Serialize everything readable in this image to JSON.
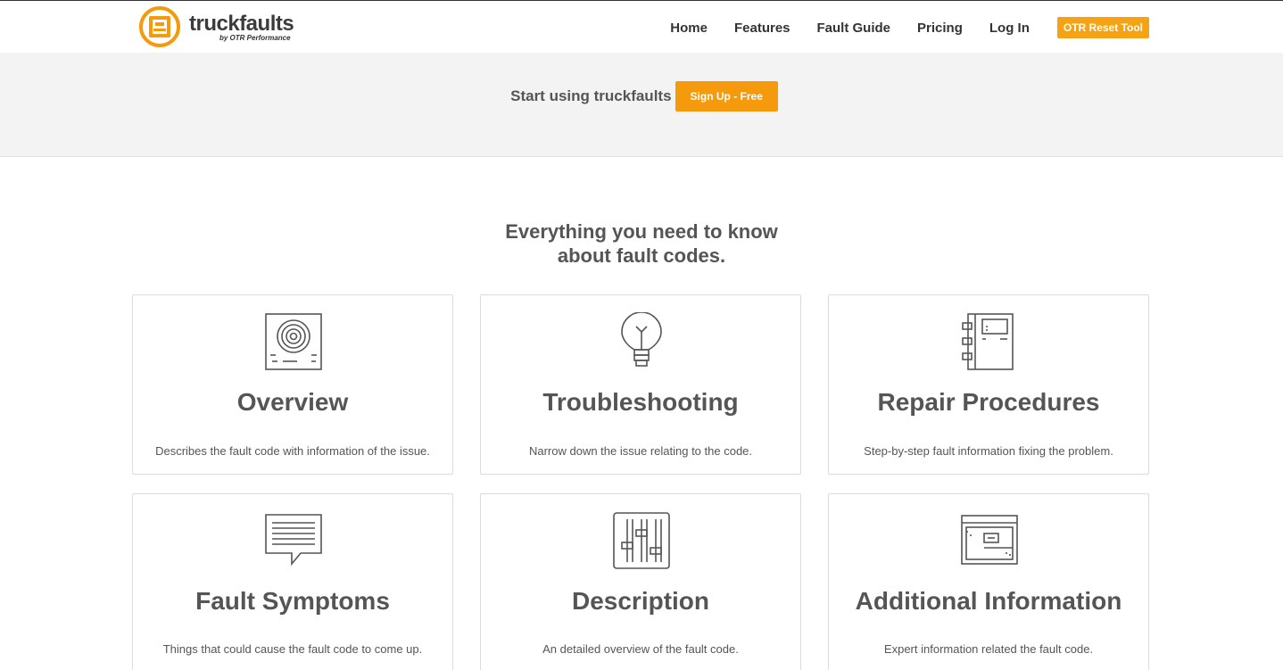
{
  "header": {
    "logo_word": "truckfaults",
    "logo_sub": "by OTR Performance",
    "nav": [
      "Home",
      "Features",
      "Fault Guide",
      "Pricing",
      "Log In"
    ],
    "reset_button": "OTR Reset Tool"
  },
  "band": {
    "text": "Start using truckfaults",
    "signup_button": "Sign Up - Free"
  },
  "main": {
    "headline_line1": "Everything you need to know",
    "headline_line2": "about fault codes.",
    "cards": [
      {
        "icon": "speaker-icon",
        "title": "Overview",
        "desc": "Describes the fault code with information of the issue."
      },
      {
        "icon": "lightbulb-icon",
        "title": "Troubleshooting",
        "desc": "Narrow down the issue relating to the code."
      },
      {
        "icon": "notebook-icon",
        "title": "Repair Procedures",
        "desc": "Step-by-step fault information fixing the problem."
      },
      {
        "icon": "chat-bubble-icon",
        "title": "Fault Symptoms",
        "desc": "Things that could cause the fault code to come up."
      },
      {
        "icon": "sliders-icon",
        "title": "Description",
        "desc": "An detailed overview of the fault code."
      },
      {
        "icon": "browser-window-icon",
        "title": "Additional Information",
        "desc": "Expert information related the fault code."
      }
    ]
  },
  "colors": {
    "accent": "#f59a0c",
    "text": "#555555",
    "band_bg": "#f3f3f3"
  }
}
